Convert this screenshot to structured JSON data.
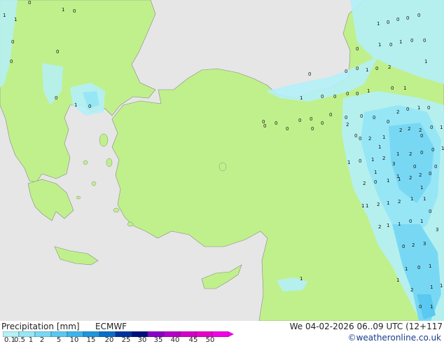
{
  "footer": {
    "title": "Precipitation [mm]",
    "model": "ECMWF",
    "datetime": "We 04-02-2026 06..09 UTC (12+117",
    "credit": "©weatheronline.co.uk"
  },
  "legend": {
    "ticks": [
      "0.1",
      "0.5",
      "1",
      "2",
      "5",
      "10",
      "15",
      "20",
      "25",
      "30",
      "35",
      "40",
      "45",
      "50"
    ],
    "colors": [
      "#b4f0f8",
      "#96e6f6",
      "#78d8f4",
      "#5ac8f0",
      "#3cb4ec",
      "#1e96dc",
      "#0a6ec8",
      "#0032a0",
      "#00107a",
      "#8a00c8",
      "#b400c8",
      "#d200c8",
      "#e600c8",
      "#f000e6"
    ]
  },
  "map": {
    "land_color": "#c0f08c",
    "sea_color": "#e6e6e6",
    "labels": [
      "0",
      "1",
      "0",
      "1",
      "1",
      "0",
      "0",
      "0",
      "0",
      "1",
      "0",
      "0",
      "0",
      "0",
      "1",
      "0",
      "2",
      "1",
      "0",
      "0",
      "0",
      "0",
      "1",
      "0",
      "1",
      "0",
      "0",
      "0",
      "1",
      "0",
      "0",
      "0",
      "1",
      "1",
      "0",
      "0",
      "1",
      "0",
      "0",
      "0",
      "0",
      "0",
      "0",
      "0",
      "2",
      "0",
      "1",
      "0",
      "0",
      "2",
      "1",
      "2",
      "2",
      "2",
      "0",
      "1",
      "1",
      "0",
      "1",
      "2",
      "1",
      "2",
      "0",
      "0",
      "1",
      "2",
      "0",
      "1",
      "1",
      "2",
      "2",
      "0",
      "1",
      "2",
      "1",
      "2",
      "1",
      "1",
      "2",
      "1",
      "1",
      "0",
      "1",
      "0",
      "2",
      "3",
      "1",
      "0",
      "1",
      "2",
      "1",
      "1",
      "1",
      "0",
      "1",
      "1",
      "1",
      "0",
      "0",
      "1",
      "1",
      "0",
      "3",
      "1",
      "0",
      "0",
      "1",
      "3",
      "2",
      "0",
      "0",
      "0",
      "0",
      "0",
      "0"
    ]
  }
}
